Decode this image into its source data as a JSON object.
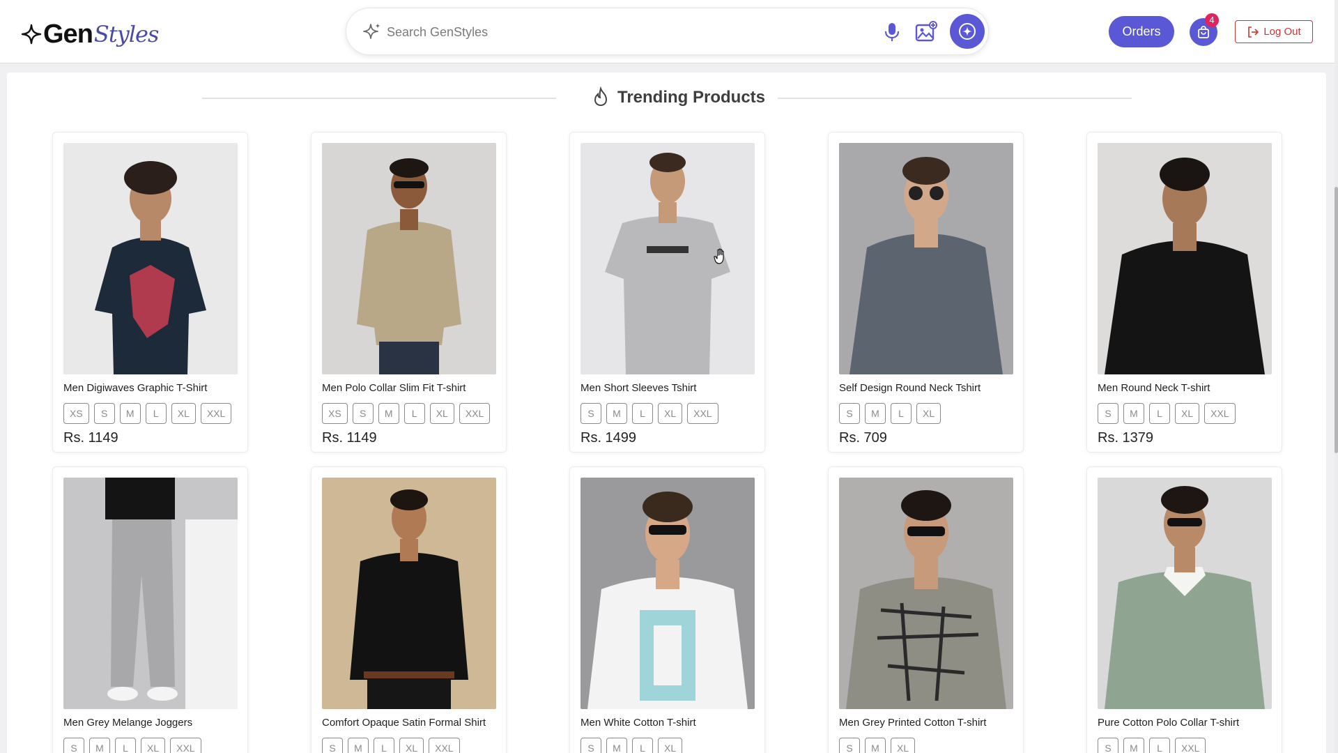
{
  "header": {
    "logo_main": "Gen",
    "logo_script": "Styles",
    "search_placeholder": "Search GenStyles",
    "orders_label": "Orders",
    "cart_count": "4",
    "logout_label": "Log Out"
  },
  "section": {
    "title": "Trending Products"
  },
  "colors": {
    "accent": "#5b58d6",
    "logout": "#cc3333",
    "badge": "#e0245e"
  },
  "products": [
    {
      "name": "Men Digiwaves Graphic T-Shirt",
      "sizes": [
        "XS",
        "S",
        "M",
        "L",
        "XL",
        "XXL"
      ],
      "price": "Rs. 1149",
      "image": "model-navy-graphic-tee"
    },
    {
      "name": "Men Polo Collar Slim Fit T-shirt",
      "sizes": [
        "XS",
        "S",
        "M",
        "L",
        "XL",
        "XXL"
      ],
      "price": "Rs. 1149",
      "image": "model-beige-knit-polo"
    },
    {
      "name": "Men Short Sleeves Tshirt",
      "sizes": [
        "S",
        "M",
        "L",
        "XL",
        "XXL"
      ],
      "price": "Rs. 1499",
      "image": "model-grey-tee"
    },
    {
      "name": "Self Design Round Neck Tshirt",
      "sizes": [
        "S",
        "M",
        "L",
        "XL"
      ],
      "price": "Rs. 709",
      "image": "model-grey-full-sleeve"
    },
    {
      "name": "Men Round Neck T-shirt",
      "sizes": [
        "S",
        "M",
        "L",
        "XL",
        "XXL"
      ],
      "price": "Rs. 1379",
      "image": "model-black-full-sleeve"
    },
    {
      "name": "Men Grey Melange Joggers",
      "sizes": [
        "S",
        "M",
        "L",
        "XL",
        "XXL"
      ],
      "image": "model-grey-joggers"
    },
    {
      "name": "Comfort Opaque Satin Formal Shirt",
      "sizes": [
        "S",
        "M",
        "L",
        "XL",
        "XXL"
      ],
      "image": "model-black-satin-shirt"
    },
    {
      "name": "Men White Cotton T-shirt",
      "sizes": [
        "S",
        "M",
        "L",
        "XL"
      ],
      "image": "model-white-print-tee"
    },
    {
      "name": "Men Grey Printed Cotton T-shirt",
      "sizes": [
        "S",
        "M",
        "XL"
      ],
      "image": "model-grey-printed-tee"
    },
    {
      "name": "Pure Cotton Polo Collar T-shirt",
      "sizes": [
        "S",
        "M",
        "L",
        "XXL"
      ],
      "image": "model-sage-polo"
    }
  ]
}
